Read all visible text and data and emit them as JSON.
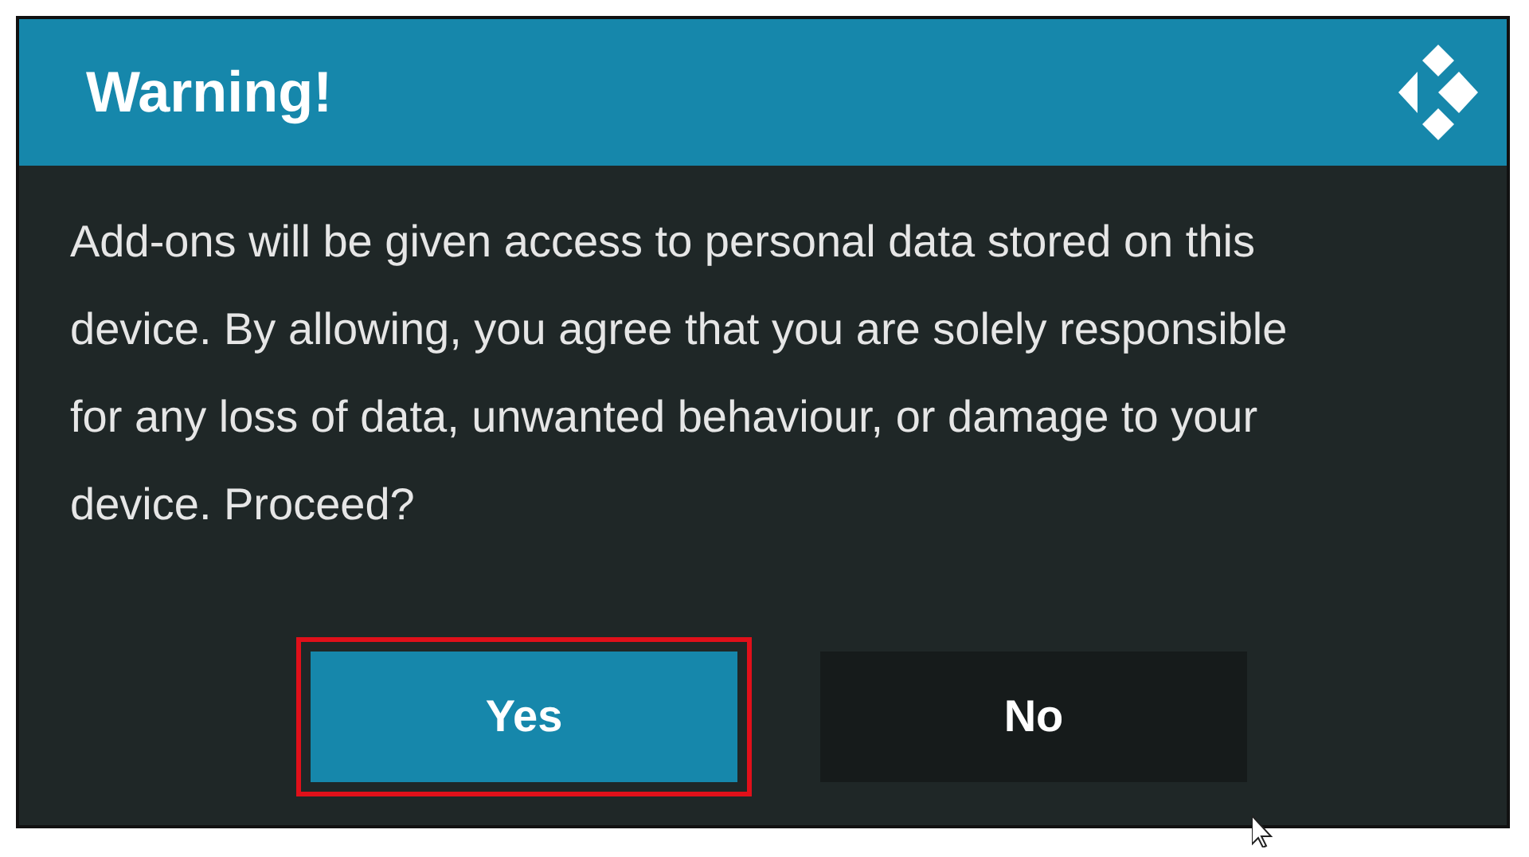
{
  "dialog": {
    "title": "Warning!",
    "message": "Add-ons will be given access to personal data stored on this\ndevice. By allowing, you agree that you are solely responsible\nfor any loss of data, unwanted behaviour, or damage to your\ndevice. Proceed?",
    "buttons": [
      {
        "label": "Yes",
        "selected": true,
        "highlighted": true
      },
      {
        "label": "No",
        "selected": false,
        "highlighted": false
      }
    ]
  }
}
